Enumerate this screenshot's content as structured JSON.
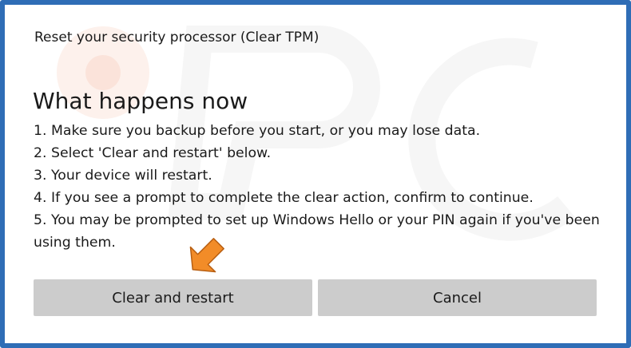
{
  "dialog": {
    "title": "Reset your security processor (Clear TPM)",
    "heading": "What happens now",
    "steps": [
      "1. Make sure you backup before you start, or you may lose data.",
      "2. Select 'Clear and restart' below.",
      "3. Your device will restart.",
      "4. If you see a prompt to complete the clear action, confirm to continue.",
      "5. You may be prompted to set up Windows Hello or your PIN again if you've been using them."
    ],
    "buttons": {
      "clear_label": "Clear and restart",
      "cancel_label": "Cancel"
    }
  },
  "annotation": {
    "arrow_color": "#f28c28",
    "arrow_icon": "arrow-pointer-icon"
  },
  "colors": {
    "frame_border": "#2f6db6",
    "button_bg": "#cccccc",
    "text": "#1a1a1a"
  }
}
